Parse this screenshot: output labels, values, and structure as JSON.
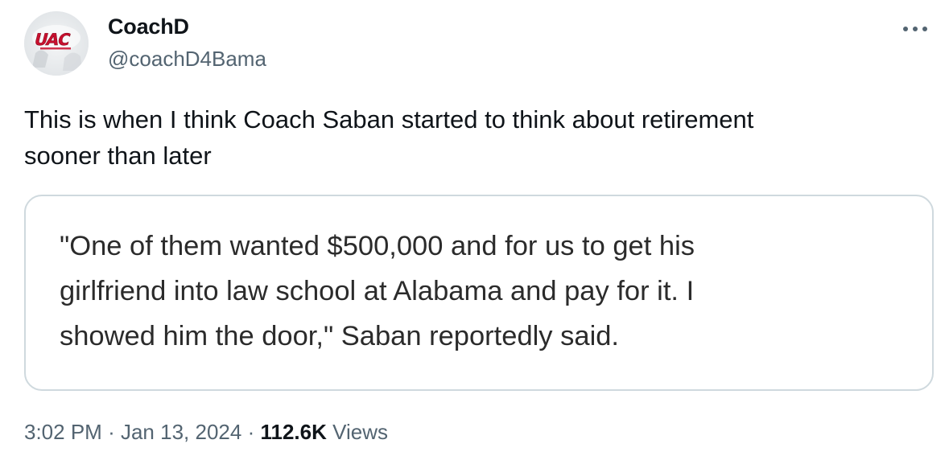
{
  "author": {
    "display_name": "CoachD",
    "handle": "@coachD4Bama",
    "avatar_logo_text": "UAC"
  },
  "tweet": {
    "text_line1": "This is when I think Coach Saban started to think about retirement",
    "text_line2": "sooner than later"
  },
  "quote_image": {
    "line1": "\"One of them wanted $500,000 and for us to get his",
    "line2": "girlfriend into law school at Alabama and pay for it. I",
    "line3": "showed him the door,\" Saban reportedly said."
  },
  "meta": {
    "time": "3:02 PM",
    "separator1": "·",
    "date": "Jan 13, 2024",
    "separator2": "·",
    "views_count": "112.6K",
    "views_label": "Views"
  },
  "colors": {
    "primary_text": "#0f1419",
    "secondary_text": "#536471",
    "card_border": "#cfd9de",
    "logo_red": "#c8102e"
  },
  "icons": {
    "more": "more-horizontal-icon",
    "avatar": "uac-logo-avatar"
  }
}
